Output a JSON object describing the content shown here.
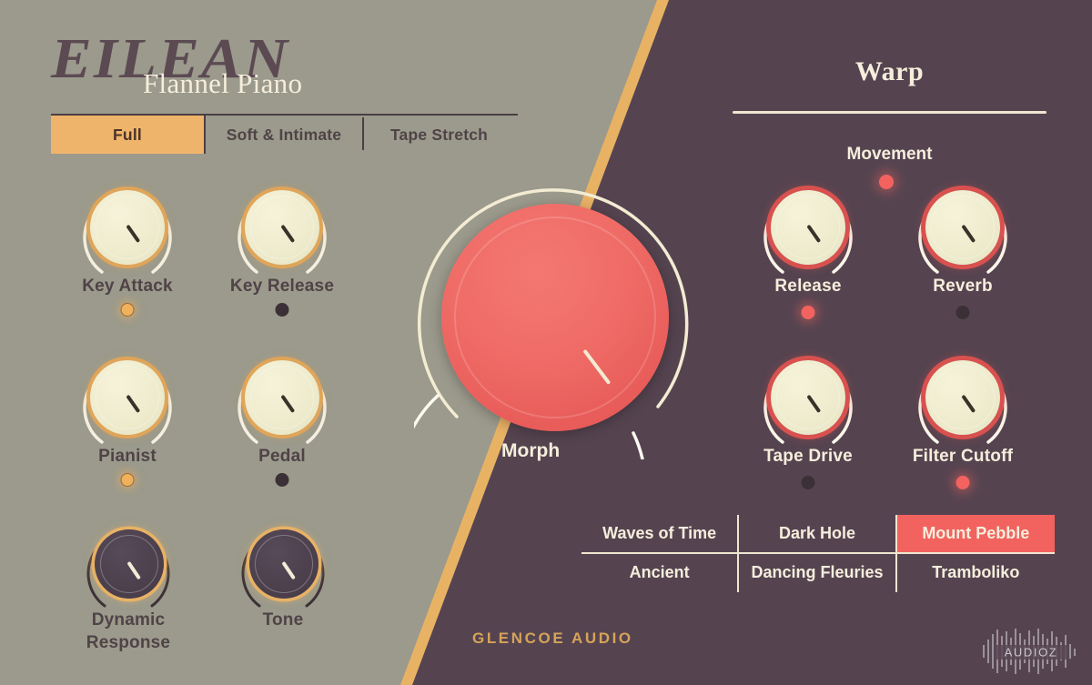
{
  "app": {
    "brand_title": "EILEAN",
    "brand_subtitle": "Flannel Piano",
    "vendor": "GLENCOE AUDIO",
    "watermark": "AUDIOZ"
  },
  "colors": {
    "panel_left_bg": "#9b9a8c",
    "panel_right_bg": "#554450",
    "divider_gold": "#e8b265",
    "accent_amber": "#efb46b",
    "accent_red": "#f2635f",
    "cream": "#f6eedc",
    "text_dark": "#4f4347"
  },
  "tabs": [
    {
      "label": "Full",
      "active": true
    },
    {
      "label": "Soft & Intimate",
      "active": false
    },
    {
      "label": "Tape Stretch",
      "active": false
    }
  ],
  "left_knobs": [
    {
      "label": "Key Attack",
      "led": "on",
      "style": "light"
    },
    {
      "label": "Key Release",
      "led": "off",
      "style": "light"
    },
    {
      "label": "Pianist",
      "led": "on",
      "style": "light"
    },
    {
      "label": "Pedal",
      "led": "off",
      "style": "light"
    },
    {
      "label": "Dynamic",
      "label2": "Response",
      "led": "none",
      "style": "dark"
    },
    {
      "label": "Tone",
      "led": "none",
      "style": "dark"
    }
  ],
  "morph": {
    "label": "Morph"
  },
  "warp": {
    "title": "Warp",
    "movement_label": "Movement",
    "movement_led": "on",
    "knobs": [
      {
        "label": "Release",
        "led": "on"
      },
      {
        "label": "Reverb",
        "led": "off"
      },
      {
        "label": "Tape Drive",
        "led": "off"
      },
      {
        "label": "Filter Cutoff",
        "led": "on"
      }
    ]
  },
  "presets": [
    {
      "label": "Waves of Time",
      "selected": false
    },
    {
      "label": "Dark Hole",
      "selected": false
    },
    {
      "label": "Mount Pebble",
      "selected": true
    },
    {
      "label": "Ancient",
      "selected": false
    },
    {
      "label": "Dancing Fleuries",
      "selected": false
    },
    {
      "label": "Tramboliko",
      "selected": false
    }
  ]
}
